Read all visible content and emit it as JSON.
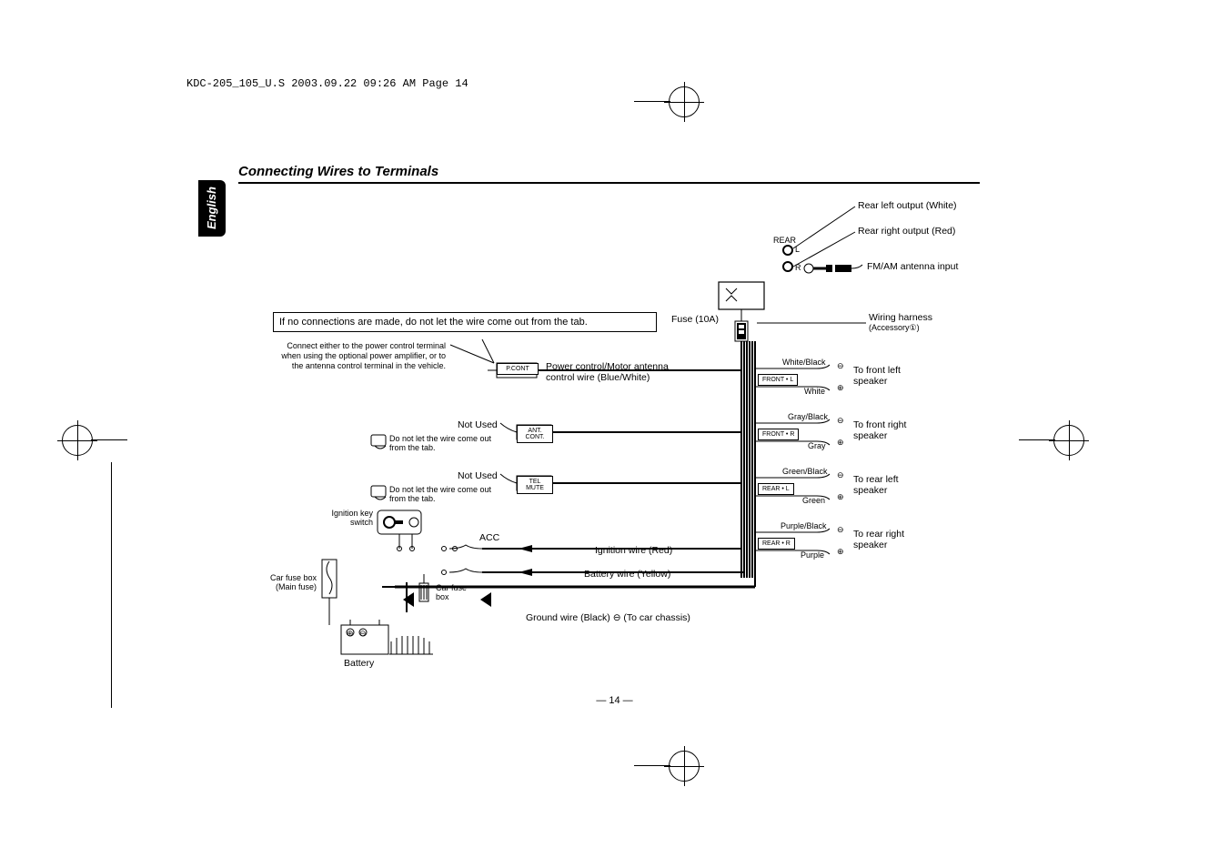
{
  "header": "KDC-205_105_U.S  2003.09.22  09:26 AM  Page 14",
  "title": "Connecting Wires to Terminals",
  "language_tab": "English",
  "page_number": "— 14 —",
  "labels": {
    "rear_left_output": "Rear left output (White)",
    "rear_right_output": "Rear right output (Red)",
    "fm_am_input": "FM/AM antenna input",
    "rear_marker": "REAR",
    "rear_l_marker": "L",
    "rear_r_marker": "R",
    "fuse": "Fuse (10A)",
    "wiring_harness": "Wiring harness",
    "wiring_harness_sub": "(Accessory①)",
    "no_connections_note": "If no connections are made, do not let the wire come out from the tab.",
    "power_control_note_1": "Connect either to the power control terminal",
    "power_control_note_2": "when using the optional power amplifier, or to",
    "power_control_note_3": "the antenna control terminal in the vehicle.",
    "pcont_tab": "P.CONT",
    "power_control_wire_1": "Power control/Motor antenna",
    "power_control_wire_2": "control wire (Blue/White)",
    "not_used_1": "Not Used",
    "ant_cont_tab": "ANT. CONT.",
    "do_not_let_1": "Do not let the wire come out from the tab.",
    "not_used_2": "Not Used",
    "tel_mute_tab": "TEL MUTE",
    "do_not_let_2": "Do not let the wire come out from the tab.",
    "ignition_key": "Ignition key switch",
    "acc": "ACC",
    "ignition_wire": "Ignition wire (Red)",
    "battery_wire": "Battery wire (Yellow)",
    "car_fuse_box": "Car fuse box (Main fuse)",
    "car_fuse_box_2": "Car fuse box",
    "ground_wire": "Ground wire (Black) ⊖ (To car chassis)",
    "battery": "Battery",
    "front_l": "FRONT • L",
    "front_r": "FRONT • R",
    "rear_l": "REAR • L",
    "rear_r": "REAR • R",
    "white_black": "White/Black",
    "white": "White",
    "gray_black": "Gray/Black",
    "gray": "Gray",
    "green_black": "Green/Black",
    "green": "Green",
    "purple_black": "Purple/Black",
    "purple": "Purple",
    "to_front_left": "To front left speaker",
    "to_front_right": "To front right speaker",
    "to_rear_left": "To rear left speaker",
    "to_rear_right": "To rear right speaker",
    "minus": "⊖",
    "plus": "⊕"
  }
}
